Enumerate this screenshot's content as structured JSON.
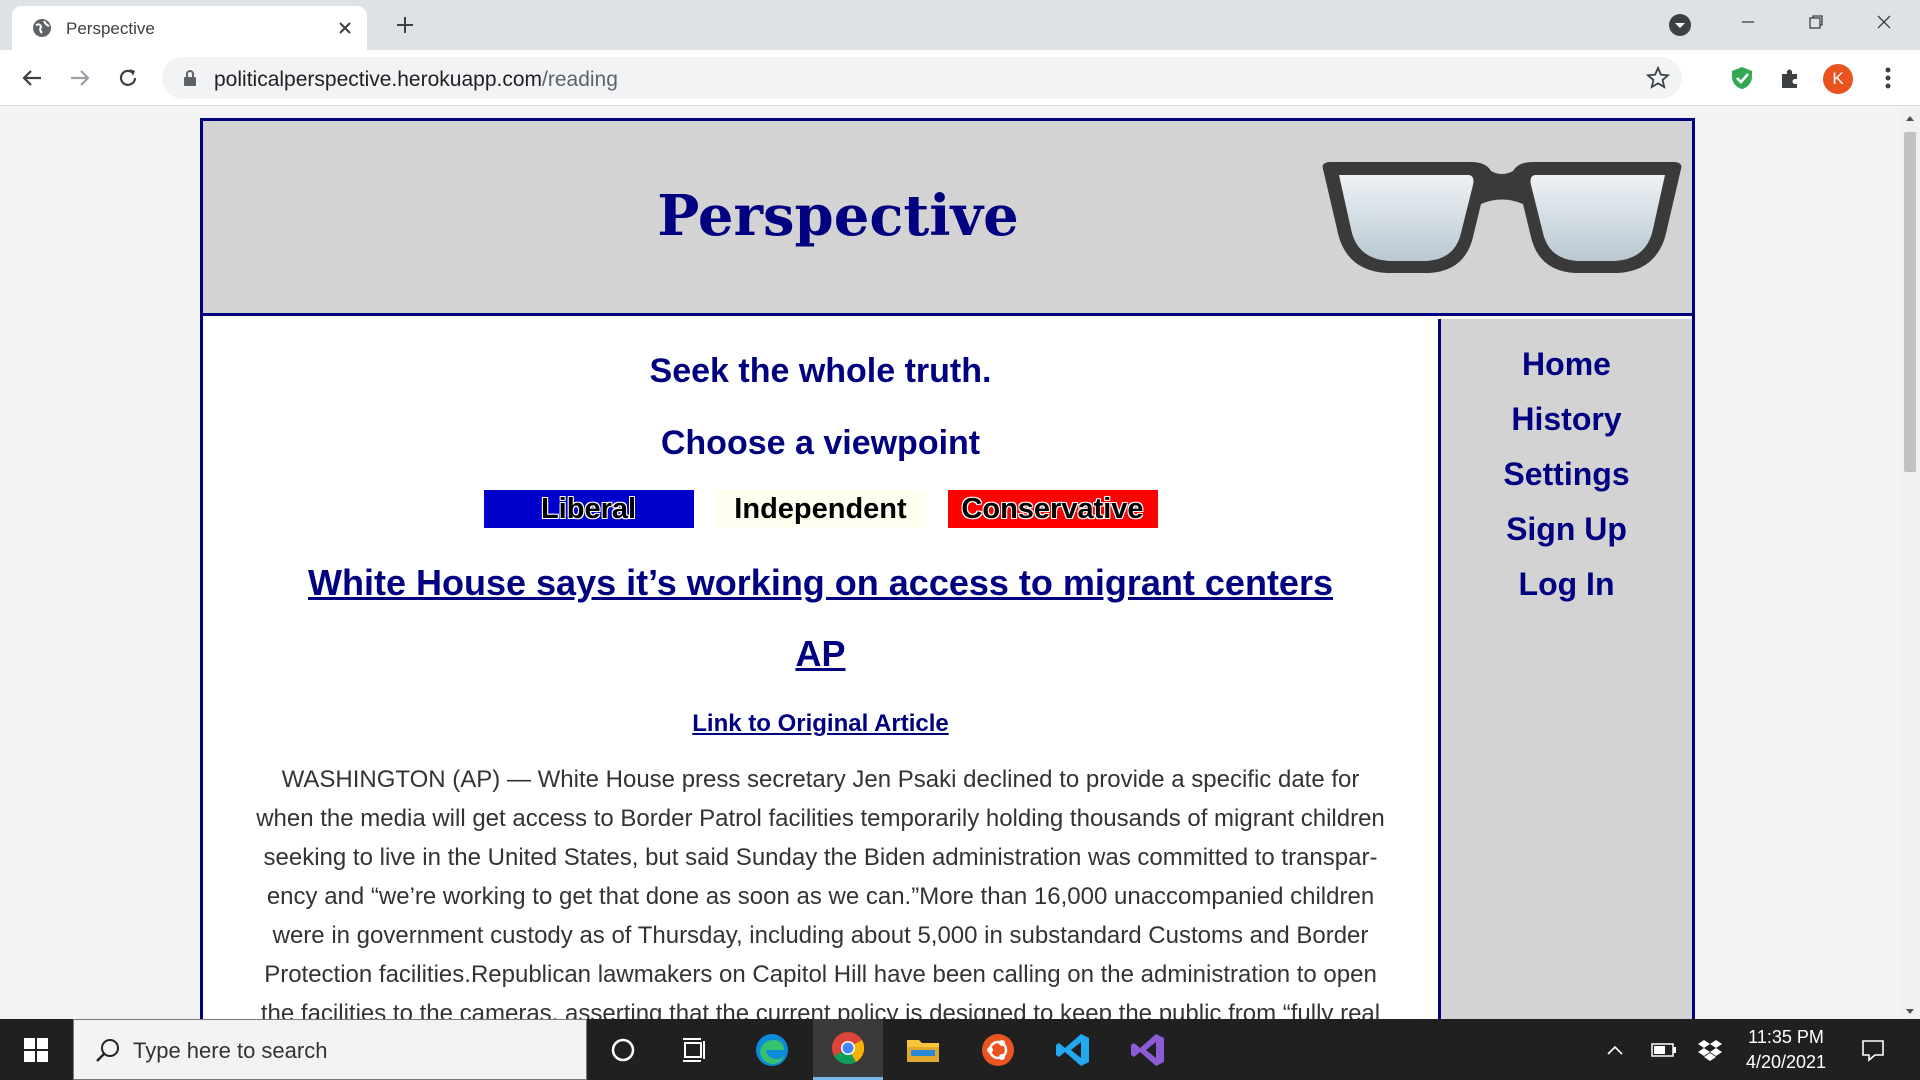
{
  "browser": {
    "tab_title": "Perspective",
    "url_domain": "politicalperspective.herokuapp.com",
    "url_path": "/reading",
    "avatar_letter": "K"
  },
  "site": {
    "title": "Perspective",
    "nav": [
      "Home",
      "History",
      "Settings",
      "Sign Up",
      "Log In"
    ],
    "tagline_1": "Seek the whole truth.",
    "tagline_2": "Choose a viewpoint",
    "viewpoints": {
      "liberal": "Liberal",
      "independent": "Independent",
      "conservative": "Conservative",
      "colors": {
        "liberal": "#0000cd",
        "independent": "#fffff0",
        "conservative": "#ff0000"
      }
    },
    "article": {
      "headline": "White House says it’s working on access to migrant centers",
      "source": "AP",
      "link_label": "Link to Original Article",
      "body": "WASHINGTON (AP) — White House press secretary Jen Psaki declined to provide a specific date for when the media will get access to Border Patrol facilities temporarily holding thousands of migrant children seeking to live in the United States, but said Sunday the Biden administration was committed to transpar-ency and “we’re working to get that done as soon as we can.”More than 16,000 unaccompanied children were in government custody as of Thursday, including about 5,000 in substandard Customs and Border Protection facilities.Republican lawmakers on Capitol Hill have been calling on the administration to open the facilities to the cameras, asserting that the current policy is designed to keep the public from “fully real"
    },
    "brand_color": "#000080"
  },
  "taskbar": {
    "search_placeholder": "Type here to search",
    "time": "11:35 PM",
    "date": "4/20/2021"
  }
}
